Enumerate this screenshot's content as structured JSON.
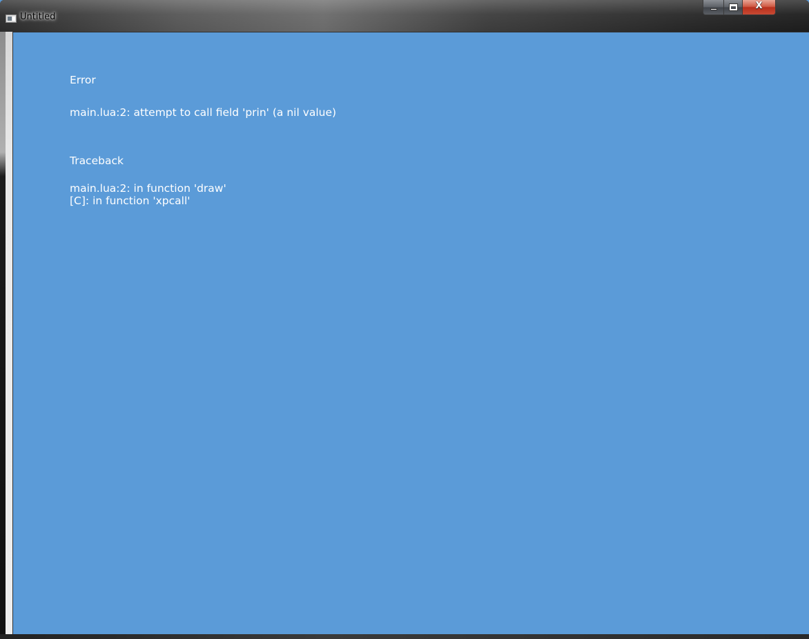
{
  "window": {
    "title": "Untitled",
    "icon": "app-window-icon",
    "buttons": {
      "minimize": "minimize-icon",
      "maximize": "maximize-icon",
      "close_label": "X"
    },
    "background_color": "#5b9bd8",
    "text_color": "#ffffff"
  },
  "error": {
    "heading": "Error",
    "message": "main.lua:2: attempt to call field 'prin' (a nil value)"
  },
  "traceback": {
    "heading": "Traceback",
    "lines": [
      "main.lua:2: in function 'draw'",
      "[C]: in function 'xpcall'"
    ]
  }
}
